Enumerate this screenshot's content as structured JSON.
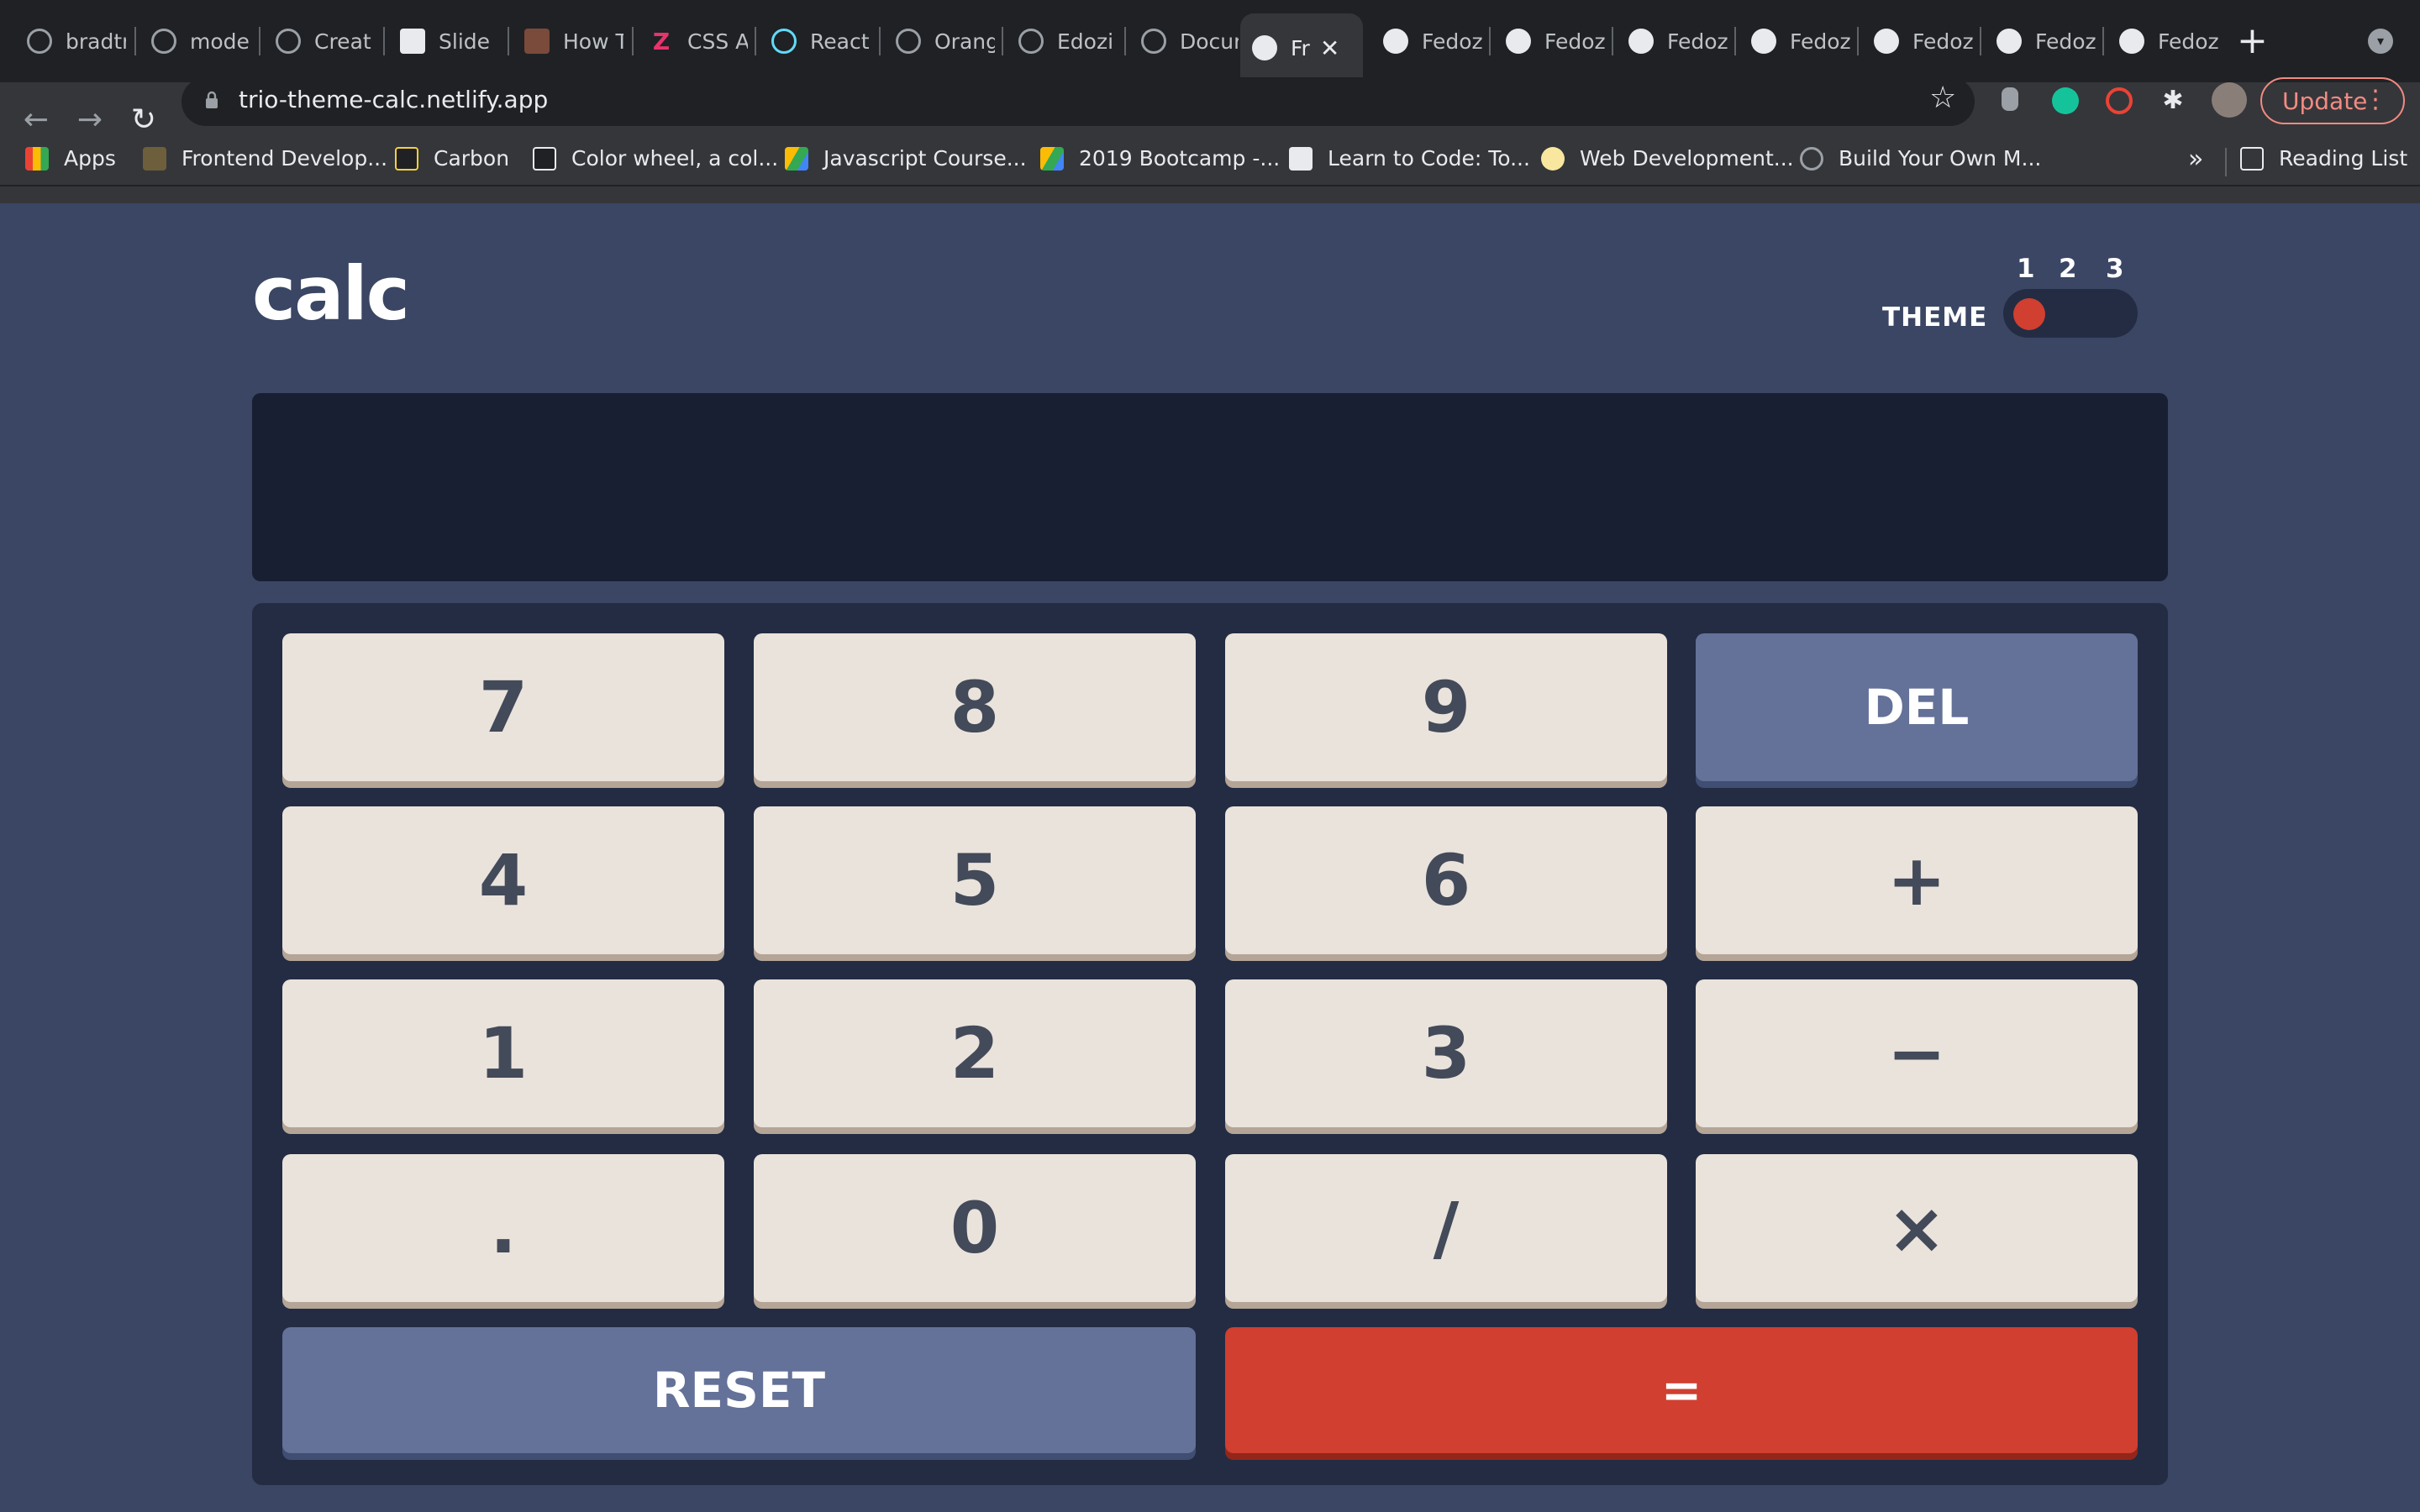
{
  "browser": {
    "tabs": [
      {
        "title": "bradtr",
        "icon": "globe-icon"
      },
      {
        "title": "mode",
        "icon": "globe-icon"
      },
      {
        "title": "Creat",
        "icon": "globe-icon"
      },
      {
        "title": "Slide",
        "icon": "codepen-icon"
      },
      {
        "title": "How T",
        "icon": "avatar-icon"
      },
      {
        "title": "CSS A",
        "icon": "z-icon"
      },
      {
        "title": "React",
        "icon": "react-icon"
      },
      {
        "title": "Orang",
        "icon": "globe-icon"
      },
      {
        "title": "Edozi",
        "icon": "globe-icon"
      },
      {
        "title": "Docur",
        "icon": "globe-icon"
      },
      {
        "title": "Fr",
        "icon": "site-icon",
        "active": true
      },
      {
        "title": "Fedoz",
        "icon": "github-icon"
      },
      {
        "title": "Fedoz",
        "icon": "github-icon"
      },
      {
        "title": "Fedoz",
        "icon": "github-icon"
      },
      {
        "title": "Fedoz",
        "icon": "github-icon"
      },
      {
        "title": "Fedoz",
        "icon": "github-icon"
      },
      {
        "title": "Fedoz",
        "icon": "github-icon"
      },
      {
        "title": "Fedoz",
        "icon": "github-icon"
      }
    ],
    "url": "trio-theme-calc.netlify.app",
    "update_label": "Update",
    "bookmarks": [
      {
        "label": "Apps",
        "icon": "apps-grid-icon"
      },
      {
        "label": "Frontend Develop...",
        "icon": "graduation-cap-icon"
      },
      {
        "label": "Carbon",
        "icon": "carbon-icon"
      },
      {
        "label": "Color wheel, a col...",
        "icon": "color-wheel-icon"
      },
      {
        "label": "Javascript Course...",
        "icon": "google-drive-icon"
      },
      {
        "label": "2019 Bootcamp -...",
        "icon": "google-drive-icon"
      },
      {
        "label": "Learn to Code: To...",
        "icon": "freecodecamp-icon"
      },
      {
        "label": "Web Development...",
        "icon": "web-dev-icon"
      },
      {
        "label": "Build Your Own M...",
        "icon": "globe-icon"
      }
    ],
    "bookmarks_more": "»",
    "reading_list": "Reading List"
  },
  "calculator": {
    "title": "calc",
    "theme_label": "THEME",
    "theme_numbers": [
      "1",
      "2",
      "3"
    ],
    "selected_theme": 1,
    "display_value": "",
    "keys": [
      [
        "7",
        "8",
        "9",
        "DEL"
      ],
      [
        "4",
        "5",
        "6",
        "+"
      ],
      [
        "1",
        "2",
        "3",
        "−"
      ],
      [
        ".",
        "0",
        "/",
        "×"
      ]
    ],
    "reset_label": "RESET",
    "equals_label": "="
  },
  "colors": {
    "page_bg": "#3a4663",
    "screen_bg": "#181f33",
    "keypad_bg": "#232c43",
    "key_bg": "#eae3dc",
    "key_text": "#434a59",
    "accent_blue": "#647198",
    "accent_red": "#d03f2f"
  }
}
